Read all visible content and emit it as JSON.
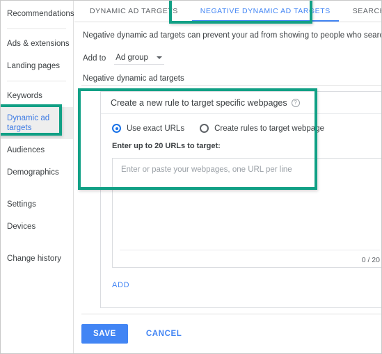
{
  "sidebar": {
    "items": [
      {
        "label": "Recommendations",
        "active": false,
        "divider_after": true
      },
      {
        "label": "Ads & extensions",
        "active": false,
        "divider_after": false
      },
      {
        "label": "Landing pages",
        "active": false,
        "divider_after": true
      },
      {
        "label": "Keywords",
        "active": false,
        "divider_after": false
      },
      {
        "label": "Dynamic ad targets",
        "active": true,
        "divider_after": false
      },
      {
        "label": "Audiences",
        "active": false,
        "divider_after": false
      },
      {
        "label": "Demographics",
        "active": false,
        "divider_after": false
      },
      {
        "label": "Settings",
        "active": false,
        "divider_after": false
      },
      {
        "label": "Devices",
        "active": false,
        "divider_after": false
      },
      {
        "label": "Change history",
        "active": false,
        "divider_after": false
      }
    ]
  },
  "tabs": [
    {
      "label": "DYNAMIC AD TARGETS",
      "active": false
    },
    {
      "label": "NEGATIVE DYNAMIC AD TARGETS",
      "active": true
    },
    {
      "label": "SEARCH TERMS",
      "active": false
    }
  ],
  "content": {
    "description": "Negative dynamic ad targets can prevent your ad from showing to people who search for or b",
    "add_to_label": "Add to",
    "add_to_value": "Ad group",
    "section_title": "Negative dynamic ad targets"
  },
  "rule_card": {
    "heading": "Create a new rule to target specific webpages",
    "help_glyph": "?",
    "radio_options": [
      {
        "label": "Use exact URLs",
        "selected": true
      },
      {
        "label": "Create rules to target webpage",
        "selected": false
      }
    ],
    "field_label": "Enter up to 20 URLs to target:",
    "textarea_placeholder": "Enter or paste your webpages, one URL per line",
    "textarea_value": "",
    "counter": "0 / 20",
    "add_label": "ADD"
  },
  "footer": {
    "save_label": "SAVE",
    "cancel_label": "CANCEL"
  },
  "colors": {
    "accent_blue": "#4285f4",
    "radio_blue": "#1a73e8",
    "annotation_teal": "#11a085",
    "active_sidebar_text": "#3c7ae4",
    "text_primary": "#3c4043",
    "text_muted": "#9aa0a6"
  }
}
